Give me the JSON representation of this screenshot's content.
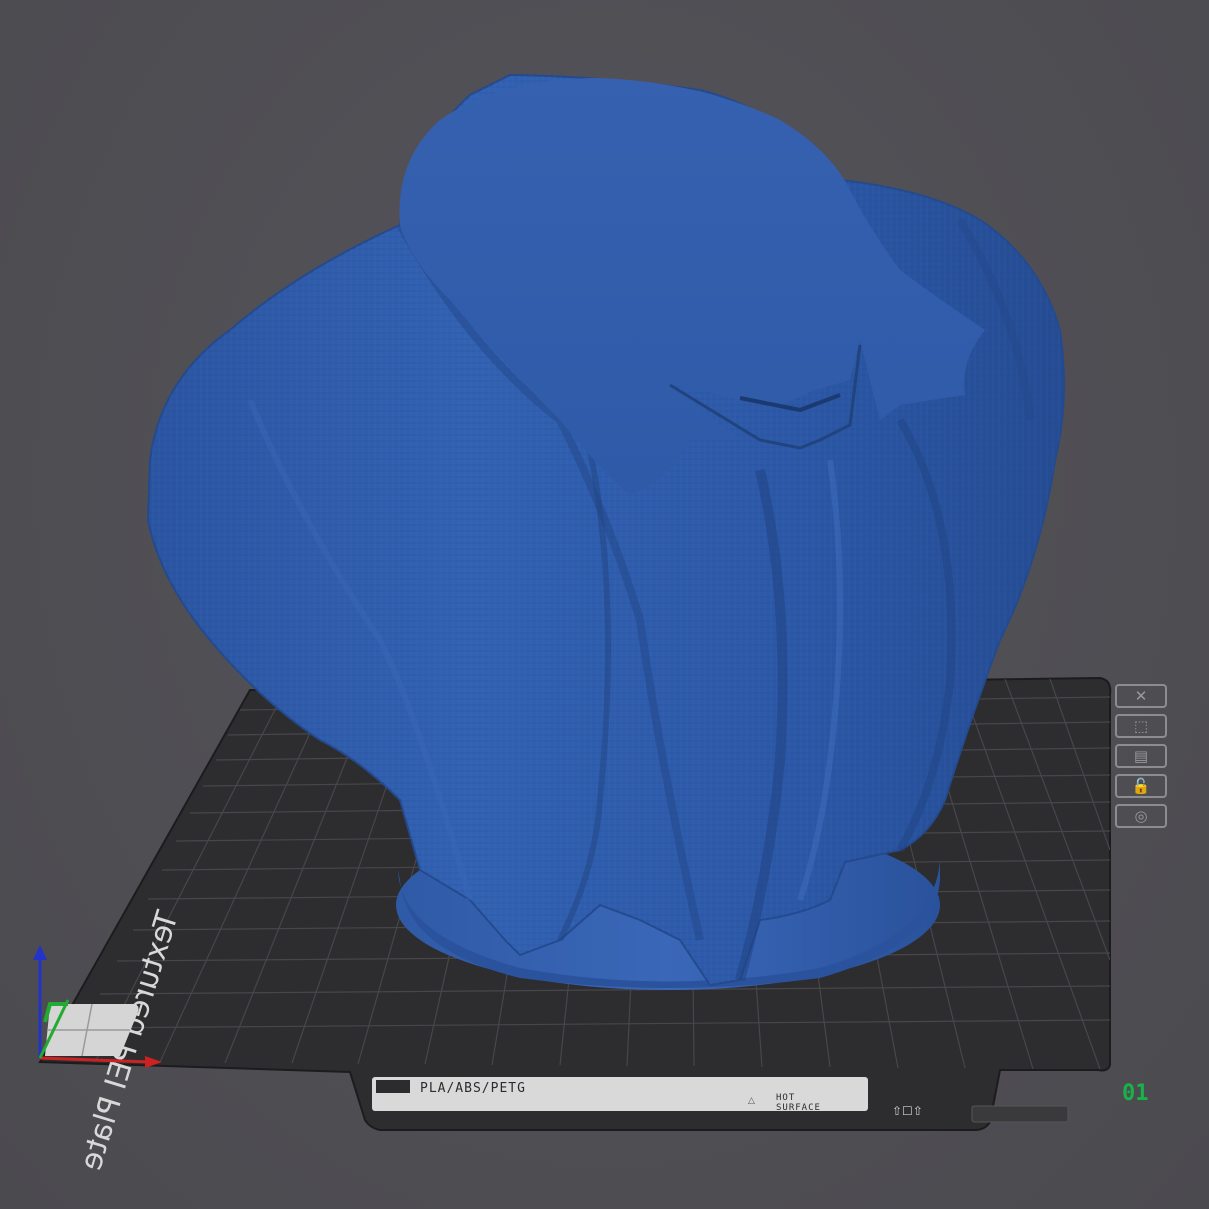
{
  "plate": {
    "name": "Textured PEI Plate",
    "filament_label": "PLA/ABS/PETG",
    "warning_label": "HOT",
    "warning_label_2": "SURFACE",
    "number": "01"
  },
  "plate_tools": [
    {
      "icon": "✕",
      "name": "close-plate-icon"
    },
    {
      "icon": "⬚",
      "name": "arrange-icon"
    },
    {
      "icon": "▤",
      "name": "orient-icon"
    },
    {
      "icon": "🔓",
      "name": "lock-icon"
    },
    {
      "icon": "◎",
      "name": "view-icon"
    }
  ],
  "colors": {
    "background": "#4f4e52",
    "plate": "#2d2d30",
    "grid": "#47474b",
    "model": "#2f5aa6",
    "axis_x": "#cc2222",
    "axis_y": "#22aa33",
    "axis_z": "#2233cc"
  }
}
